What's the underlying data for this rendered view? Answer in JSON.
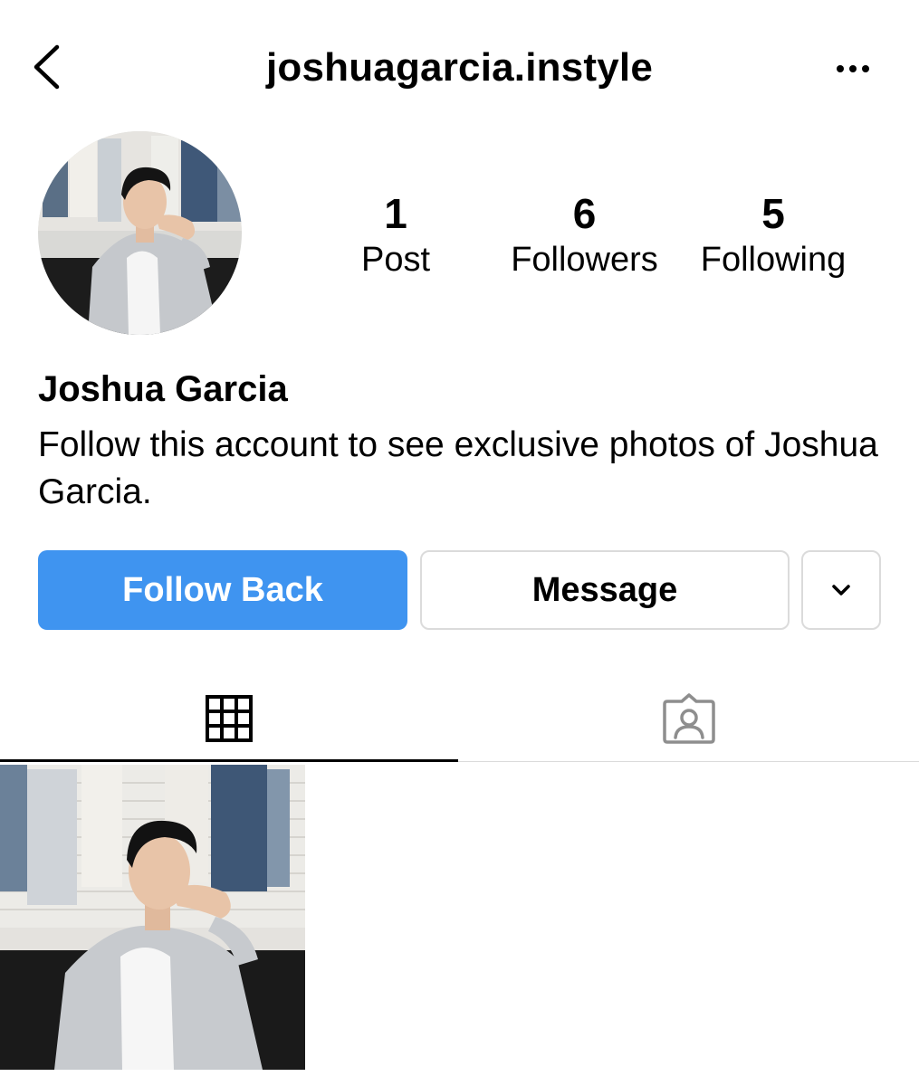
{
  "header": {
    "username": "joshuagarcia.instyle",
    "back_icon": "chevron-left-icon",
    "more_icon": "ellipsis-icon"
  },
  "profile": {
    "full_name": "Joshua Garcia",
    "bio": "Follow this account to see exclusive photos of Joshua Garcia.",
    "stats": {
      "posts": {
        "count": "1",
        "label": "Post"
      },
      "followers": {
        "count": "6",
        "label": "Followers"
      },
      "following": {
        "count": "5",
        "label": "Following"
      }
    }
  },
  "actions": {
    "follow_back_label": "Follow Back",
    "message_label": "Message",
    "dropdown_icon": "chevron-down-icon"
  },
  "tabs": [
    {
      "name": "posts",
      "icon": "grid-icon",
      "active": true
    },
    {
      "name": "tagged",
      "icon": "tagged-person-icon",
      "active": false
    }
  ],
  "colors": {
    "primary_button": "#3f94f0",
    "border": "#dbdbdb",
    "text": "#000000"
  }
}
